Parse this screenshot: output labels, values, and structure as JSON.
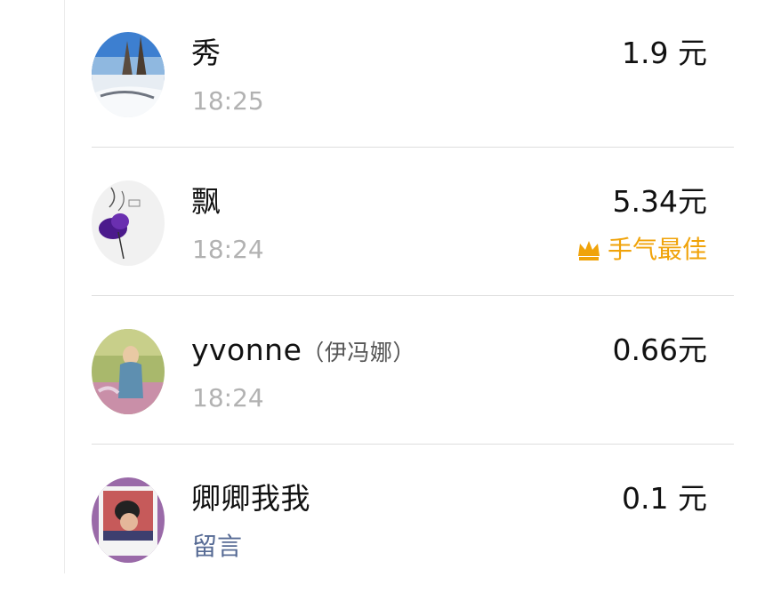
{
  "records": [
    {
      "name": "秀",
      "nickname": "",
      "sub": "18:25",
      "sub_is_link": false,
      "amount": "1.9 元",
      "best": ""
    },
    {
      "name": "飘",
      "nickname": "",
      "sub": "18:24",
      "sub_is_link": false,
      "amount": "5.34元",
      "best": "手气最佳"
    },
    {
      "name": "yvonne",
      "nickname": "（伊冯娜）",
      "sub": "18:24",
      "sub_is_link": false,
      "amount": "0.66元",
      "best": ""
    },
    {
      "name": "卿卿我我",
      "nickname": "",
      "sub": "留言",
      "sub_is_link": true,
      "amount": "0.1 元",
      "best": ""
    }
  ],
  "colors": {
    "best_accent": "#f0a30a",
    "link": "#576b95",
    "time": "#b2b2b2",
    "divider": "#dedede"
  },
  "icons": {
    "best_badge": "crown-icon"
  }
}
